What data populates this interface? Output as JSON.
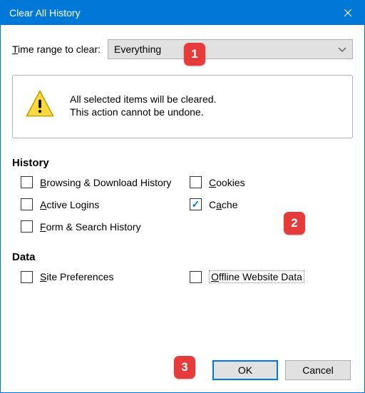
{
  "window": {
    "title": "Clear All History"
  },
  "timerange": {
    "label": "Time range to clear:",
    "value": "Everything"
  },
  "warning": {
    "line1": "All selected items will be cleared.",
    "line2": "This action cannot be undone."
  },
  "sections": {
    "history": {
      "title": "History",
      "items": [
        {
          "label": "Browsing & Download History",
          "checked": false
        },
        {
          "label": "Cookies",
          "checked": false
        },
        {
          "label": "Active Logins",
          "checked": false
        },
        {
          "label": "Cache",
          "checked": true
        },
        {
          "label": "Form & Search History",
          "checked": false
        }
      ]
    },
    "data": {
      "title": "Data",
      "items": [
        {
          "label": "Site Preferences",
          "checked": false
        },
        {
          "label": "Offline Website Data",
          "checked": false
        }
      ]
    }
  },
  "buttons": {
    "ok": "OK",
    "cancel": "Cancel"
  },
  "callouts": {
    "c1": "1",
    "c2": "2",
    "c3": "3"
  }
}
